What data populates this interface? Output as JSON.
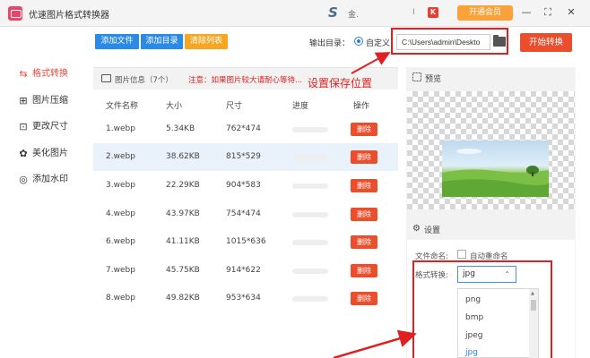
{
  "titlebar": {
    "app_title": "优速图片格式转换器",
    "user_glyph": "S",
    "user_name": "金.",
    "separator": "I",
    "brand_glyph": "K",
    "vip_label": "开通会员",
    "minimize": "—",
    "maximize": "⛶",
    "close": "✕"
  },
  "sidebar": {
    "items": [
      {
        "label": "格式转换",
        "icon": "swap-icon",
        "glyph": "⇆"
      },
      {
        "label": "图片压缩",
        "icon": "compress-icon",
        "glyph": "⊞"
      },
      {
        "label": "更改尺寸",
        "icon": "resize-icon",
        "glyph": "⊡"
      },
      {
        "label": "美化图片",
        "icon": "beautify-icon",
        "glyph": "✿"
      },
      {
        "label": "添加水印",
        "icon": "watermark-icon",
        "glyph": "◎"
      }
    ]
  },
  "toolbar": {
    "add_file": "添加文件",
    "add_folder": "添加目录",
    "clear_list": "清除列表",
    "output_label": "输出目录：",
    "custom_label": "自定义",
    "output_path": "C:\\Users\\admin\\Deskto",
    "start": "开始转换"
  },
  "info_bar": {
    "count_text": "图片信息（7个）",
    "warning": "注意：如果图片较大请耐心等待..."
  },
  "table": {
    "headers": [
      "文件名称",
      "大小",
      "尺寸",
      "进度",
      "操作"
    ],
    "delete_label": "删除",
    "rows": [
      {
        "name": "1.webp",
        "size": "5.34KB",
        "dims": "762*474"
      },
      {
        "name": "2.webp",
        "size": "38.62KB",
        "dims": "815*529"
      },
      {
        "name": "3.webp",
        "size": "22.29KB",
        "dims": "904*583"
      },
      {
        "name": "4.webp",
        "size": "43.97KB",
        "dims": "754*474"
      },
      {
        "name": "6.webp",
        "size": "41.11KB",
        "dims": "1015*636"
      },
      {
        "name": "7.webp",
        "size": "45.75KB",
        "dims": "914*622"
      },
      {
        "name": "8.webp",
        "size": "49.82KB",
        "dims": "953*634"
      }
    ],
    "highlighted_row": 1
  },
  "preview": {
    "label": "预览"
  },
  "settings": {
    "label": "设置",
    "filename_label": "文件命名:",
    "auto_rename": "自动重命名",
    "format_label": "格式转换:",
    "format_value": "jpg",
    "format_options": [
      "png",
      "bmp",
      "jpeg",
      "jpg"
    ]
  },
  "annotation": {
    "text": "设置保存位置"
  },
  "colors": {
    "accent_red": "#e02020",
    "button_blue": "#2b8ae6",
    "button_yellow": "#f5a623",
    "action_orange": "#ea4e2c",
    "vip_orange": "#f9a23a"
  }
}
